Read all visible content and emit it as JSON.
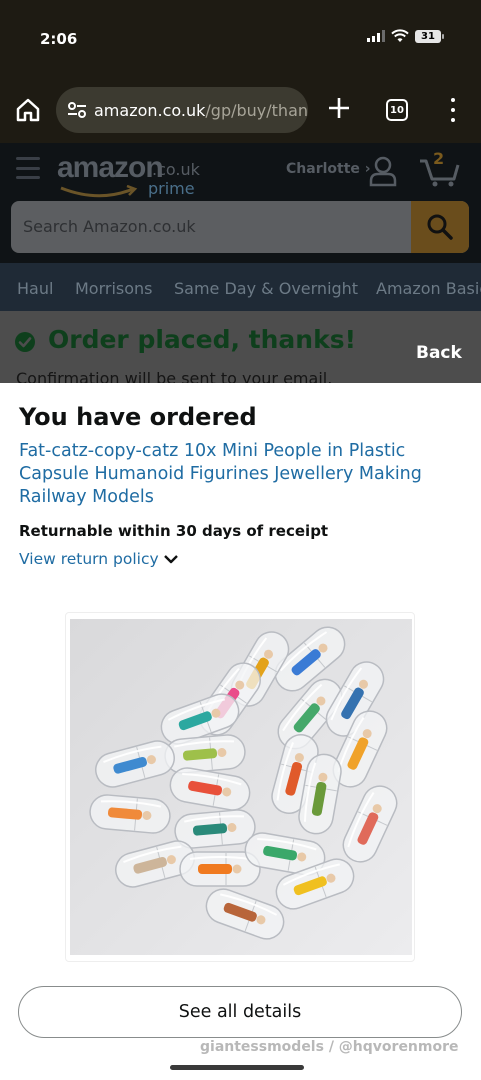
{
  "status_bar": {
    "time": "2:06",
    "battery": "31"
  },
  "browser": {
    "url_host": "amazon.co.uk",
    "url_path": "/gp/buy/thanky",
    "tab_count": "10"
  },
  "amazon_header": {
    "logo_word": "amazon",
    "logo_tld": ".co.uk",
    "logo_prime": "prime",
    "account_name": "Charlotte ›",
    "cart_count": "2",
    "search_placeholder": "Search Amazon.co.uk",
    "nav_items": [
      "Haul",
      "Morrisons",
      "Same Day & Overnight",
      "Amazon Basics"
    ]
  },
  "banner": {
    "headline": "Order placed, thanks!",
    "subtext": "Confirmation will be sent to your email.",
    "back_label": "Back"
  },
  "sheet": {
    "heading": "You have ordered",
    "product_title": "Fat-catz-copy-catz 10x Mini People in Plastic Capsule Humanoid Figurines Jewellery Making Railway Models",
    "returnable": "Returnable within 30 days of receipt",
    "policy_link": "View return policy",
    "details_button": "See all details",
    "watermark": "giantessmodels / @hqvorenmore"
  },
  "colors": {
    "link": "#1f6ca3",
    "success_green": "#0e3f1c",
    "browser_bg": "#1e1b13"
  }
}
